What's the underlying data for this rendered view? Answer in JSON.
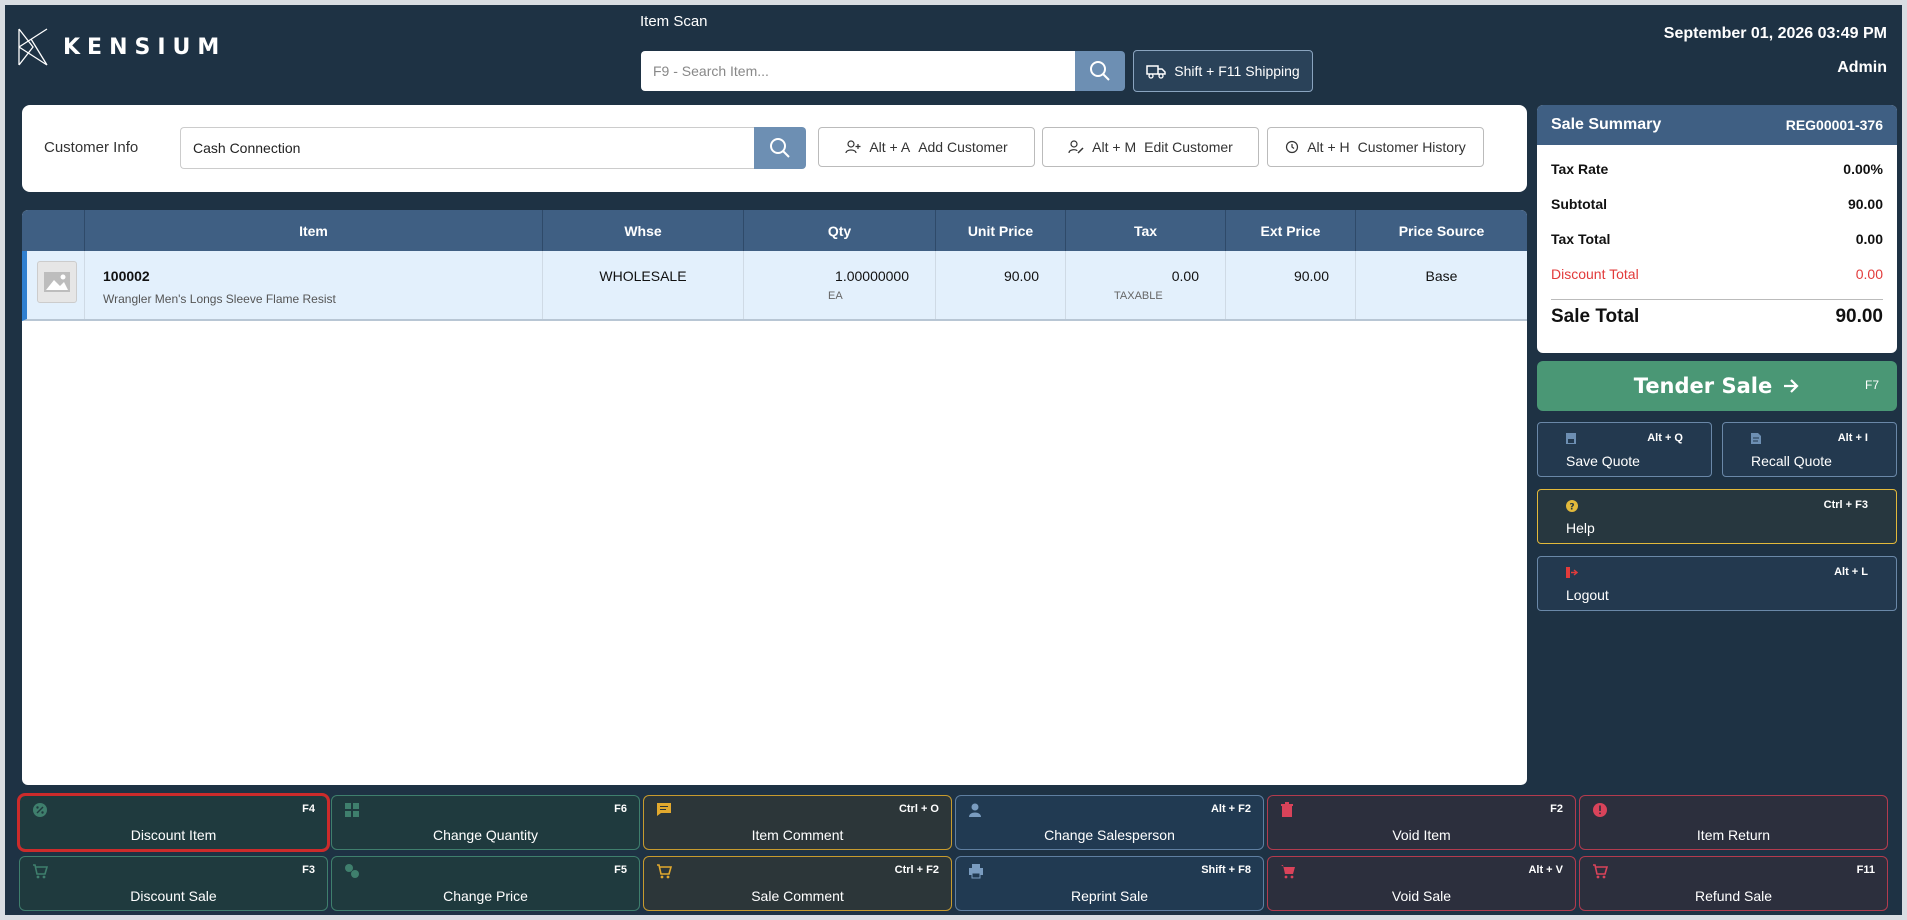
{
  "header": {
    "logo_text": "KENSIUM",
    "scan_label": "Item Scan",
    "search_placeholder": "F9 - Search Item...",
    "shipping_label": "Shift + F11 Shipping",
    "datetime": "September 01, 2026 03:49 PM",
    "user": "Admin"
  },
  "customer": {
    "label": "Customer Info",
    "value": "Cash Connection",
    "buttons": [
      {
        "key": "Alt + A",
        "label": "Add Customer",
        "icon": "add-user-icon"
      },
      {
        "key": "Alt + M",
        "label": "Edit Customer",
        "icon": "edit-user-icon"
      },
      {
        "key": "Alt + H",
        "label": "Customer History",
        "icon": "history-icon"
      }
    ]
  },
  "table": {
    "columns": [
      "",
      "Item",
      "Whse",
      "Qty",
      "Unit Price",
      "Tax",
      "Ext Price",
      "Price Source"
    ],
    "rows": [
      {
        "item_code": "100002",
        "item_desc": "Wrangler Men's Longs Sleeve Flame Resist",
        "whse": "WHOLESALE",
        "qty": "1.00000000",
        "uom": "EA",
        "unit_price": "90.00",
        "tax": "0.00",
        "tax_status": "TAXABLE",
        "ext_price": "90.00",
        "price_source": "Base"
      }
    ]
  },
  "summary": {
    "title": "Sale Summary",
    "register": "REG00001-376",
    "rows": [
      {
        "label": "Tax Rate",
        "value": "0.00%"
      },
      {
        "label": "Subtotal",
        "value": "90.00"
      },
      {
        "label": "Tax Total",
        "value": "0.00"
      }
    ],
    "discount_label": "Discount Total",
    "discount_value": "0.00",
    "total_label": "Sale Total",
    "total_value": "90.00"
  },
  "tender": {
    "label": "Tender Sale",
    "key": "F7"
  },
  "side": {
    "save_quote": {
      "label": "Save Quote",
      "key": "Alt + Q"
    },
    "recall_quote": {
      "label": "Recall Quote",
      "key": "Alt + I"
    },
    "help": {
      "label": "Help",
      "key": "Ctrl + F3"
    },
    "logout": {
      "label": "Logout",
      "key": "Alt + L"
    }
  },
  "functions": {
    "discount_item": {
      "label": "Discount Item",
      "key": "F4"
    },
    "change_quantity": {
      "label": "Change Quantity",
      "key": "F6"
    },
    "item_comment": {
      "label": "Item Comment",
      "key": "Ctrl + O"
    },
    "change_salesperson": {
      "label": "Change Salesperson",
      "key": "Alt + F2"
    },
    "void_item": {
      "label": "Void Item",
      "key": "F2"
    },
    "item_return": {
      "label": "Item Return",
      "key": ""
    },
    "discount_sale": {
      "label": "Discount Sale",
      "key": "F3"
    },
    "change_price": {
      "label": "Change Price",
      "key": "F5"
    },
    "sale_comment": {
      "label": "Sale Comment",
      "key": "Ctrl + F2"
    },
    "reprint_sale": {
      "label": "Reprint Sale",
      "key": "Shift + F8"
    },
    "void_sale": {
      "label": "Void Sale",
      "key": "Alt + V"
    },
    "refund_sale": {
      "label": "Refund Sale",
      "key": "F11"
    }
  },
  "colors": {
    "background": "#1e3244",
    "header_row": "#3f5f83",
    "tender": "#4a9775",
    "discount_red": "#e23b3b"
  }
}
